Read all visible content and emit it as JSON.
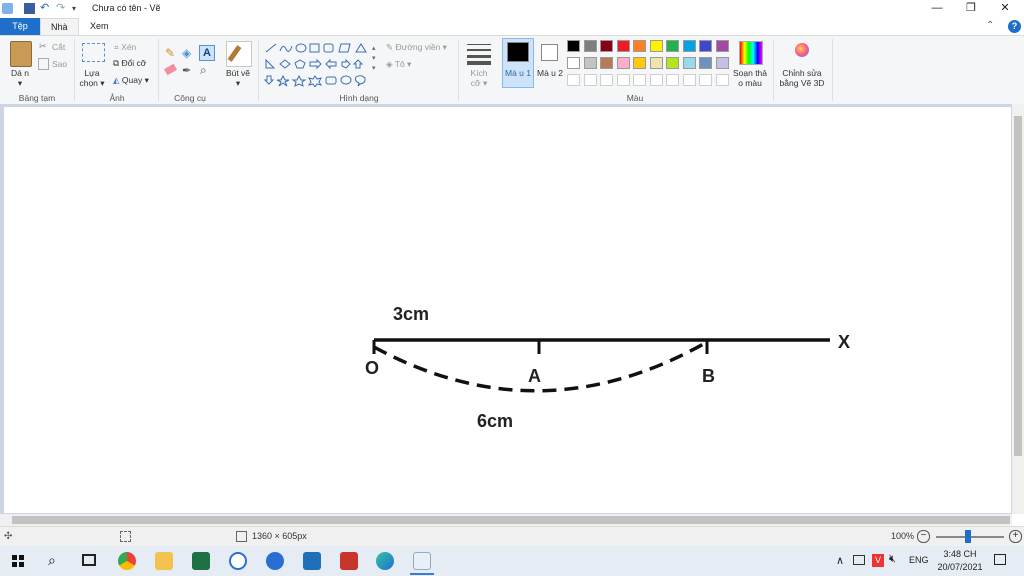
{
  "title_bar": {
    "title": "Chưa có tên - Vẽ",
    "minimize_glyph": "—",
    "restore_glyph": "❐",
    "close_glyph": "✕"
  },
  "tabs": [
    {
      "label": "Tệp"
    },
    {
      "label": "Nhà"
    },
    {
      "label": "Xem"
    }
  ],
  "ribbon": {
    "help_glyph": "?",
    "collapse_glyph": "⌃",
    "clipboard": {
      "paste_label": "Dá n ▾",
      "cut_label": "Cắt",
      "copy_label": "Sao",
      "group_label": "Bảng tạm"
    },
    "image": {
      "select_label": "Lựa chọn ▾",
      "crop_label": "Xén",
      "resize_label": "Đổi cỡ",
      "rotate_label": "Quay ▾",
      "group_label": "Ảnh"
    },
    "tools": {
      "group_label": "Công cụ"
    },
    "brushes": {
      "label": "Bút vẽ ▾"
    },
    "shapes": {
      "outline_label": "Đường viền ▾",
      "fill_label": "Tô ▾",
      "group_label": "Hình dạng"
    },
    "size": {
      "label": "Kích cỡ ▾"
    },
    "color1": {
      "label": "Mà u 1",
      "color": "#000000"
    },
    "color2": {
      "label": "Mà u 2",
      "color": "#ffffff"
    },
    "colors": {
      "group_label": "Màu",
      "palette_row1": [
        "#000000",
        "#7f7f7f",
        "#880015",
        "#ed1c24",
        "#ff7f27",
        "#fff200",
        "#22b14c",
        "#00a2e8",
        "#3f48cc",
        "#a349a4"
      ],
      "palette_row2": [
        "#ffffff",
        "#c3c3c3",
        "#b97a57",
        "#ffaec9",
        "#ffc90e",
        "#efe4b0",
        "#b5e61d",
        "#99d9ea",
        "#7092be",
        "#c8bfe7"
      ],
      "palette_row3": [
        "#ffffff",
        "#ffffff",
        "#ffffff",
        "#ffffff",
        "#ffffff",
        "#ffffff",
        "#ffffff",
        "#ffffff",
        "#ffffff",
        "#ffffff"
      ]
    },
    "edit_colors": {
      "label": "Soạn thả o màu"
    },
    "paint3d": {
      "label": "Chỉnh sửa bằng Vẽ 3D"
    }
  },
  "drawing": {
    "label_3cm": "3cm",
    "label_6cm": "6cm",
    "label_O": "O",
    "label_A": "A",
    "label_B": "B",
    "label_X": "X"
  },
  "status_bar": {
    "image_size": "1360 × 605px",
    "zoom": "100%"
  },
  "taskbar": {
    "language": "ENG",
    "time": "3:48 CH",
    "date": "20/07/2021"
  }
}
